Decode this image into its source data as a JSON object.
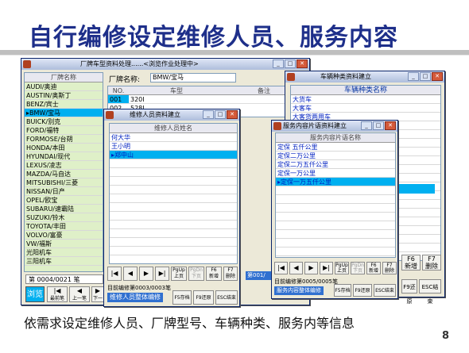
{
  "slide": {
    "title": "自行编修设定维修人员、服务内容",
    "caption": "依需求设定维修人员、厂牌型号、车辆种类、服务内等信息",
    "page_number": "8"
  },
  "win_brand": {
    "title": "厂牌车型资料处理......<浏览作业处理中>",
    "col_header": "厂牌名称",
    "items": [
      "AUDI/奥迪",
      "AUSTIN/奥斯丁",
      "BENZ/宾士",
      "BMW/宝马",
      "BUICK/别克",
      "FORD/福特",
      "FORMOSE/台朔",
      "HONDA/本田",
      "HYUNDAI/现代",
      "LEXUS/凌志",
      "MAZDA/马自达",
      "MITSUBISHI/三菱",
      "NISSAN/日产",
      "OPEL/欧宝",
      "SUBARU/速霸陆",
      "SUZUKI/铃木",
      "TOYOTA/丰田",
      "VOLVO/富豪",
      "VW/福斯",
      "光阳机车",
      "三阳机车"
    ],
    "selected_index": 3,
    "brand_label": "厂牌名称:",
    "brand_value": "BMW/宝马",
    "model_headers": [
      "NO.",
      "车型",
      "备注"
    ],
    "models": [
      [
        "001",
        "320I"
      ],
      [
        "002",
        "528I"
      ]
    ],
    "record_status": "第 0004/0021 笔",
    "browse_label": "浏览",
    "nav_buttons": [
      "最前笔",
      "上一笔",
      "下一"
    ]
  },
  "win_staff": {
    "title": "维修人员资料建立",
    "col_header": "维修人员姓名",
    "items": [
      "何大华",
      "王小明",
      "郑中山"
    ],
    "selected_index": 2,
    "status": "目前编修第0003/0003笔",
    "mode_label": "维修人员整体编修",
    "buttons": [
      "PgUp\n上页",
      "PgDn\n下页",
      "F6\n新增",
      "F7\n删除"
    ],
    "bottom_buttons": [
      "F5存档",
      "F9还原",
      "ESC结束"
    ],
    "partial_label": "第001/"
  },
  "win_vehicle": {
    "title": "车辆种类资料建立",
    "col_header": "车辆种类名称",
    "items": [
      "大货车",
      "大客车",
      "大客货两用车"
    ],
    "buttons": [
      "F6\n新增",
      "F7\n删除"
    ],
    "bottom_buttons": [
      "F9还原",
      "ESC结束"
    ]
  },
  "win_service": {
    "title": "服务内容片语资料建立",
    "col_header": "服务内容片语名称",
    "items": [
      "定保 五仟公里",
      "定保二万公里",
      "定保二万五仟公里",
      "定保一万公里",
      "定保一万五仟公里"
    ],
    "selected_index": 4,
    "status": "目前编修第0005/0005笔",
    "mode_label": "服务内容整体编修",
    "buttons": [
      "PgUp\n上页",
      "PgDn\n下页",
      "F6\n新增",
      "F7\n删除"
    ],
    "bottom_buttons": [
      "F5存档",
      "F9还原",
      "ESC结束"
    ]
  }
}
